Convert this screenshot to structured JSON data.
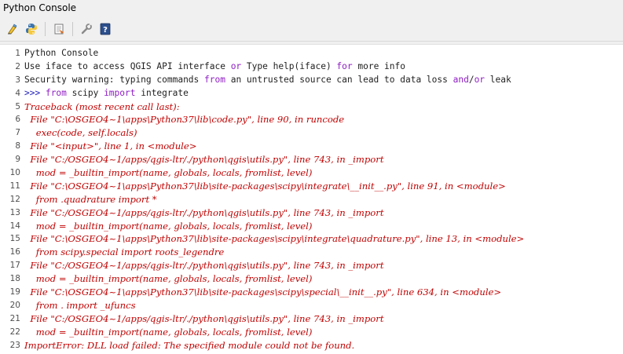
{
  "window": {
    "title": "Python Console"
  },
  "toolbar": {
    "icons": [
      "clear-console-icon",
      "python-icon",
      "run-script-icon",
      "settings-wrench-icon",
      "help-icon"
    ]
  },
  "colors": {
    "error_text": "#c00000",
    "keyword": "#8f1ec4",
    "prompt": "#2020c0",
    "line_number": "#505050"
  },
  "console": {
    "lines": [
      {
        "n": "1",
        "type": "normal",
        "segments": [
          {
            "t": "Python Console"
          }
        ]
      },
      {
        "n": "2",
        "type": "normal",
        "segments": [
          {
            "t": "Use iface to access QGIS API interface "
          },
          {
            "t": "or",
            "kw": true
          },
          {
            "t": " Type help(iface) "
          },
          {
            "t": "for",
            "kw": true
          },
          {
            "t": " more info"
          }
        ]
      },
      {
        "n": "3",
        "type": "normal",
        "segments": [
          {
            "t": "Security warning: typing commands "
          },
          {
            "t": "from",
            "kw": true
          },
          {
            "t": " an untrusted source can lead to data loss "
          },
          {
            "t": "and",
            "kw": true
          },
          {
            "t": "/"
          },
          {
            "t": "or",
            "kw": true
          },
          {
            "t": " leak"
          }
        ]
      },
      {
        "n": "4",
        "type": "normal",
        "segments": [
          {
            "t": ">>> ",
            "prompt": true
          },
          {
            "t": "from",
            "kw": true
          },
          {
            "t": " scipy "
          },
          {
            "t": "import",
            "kw": true
          },
          {
            "t": " integrate"
          }
        ]
      },
      {
        "n": "5",
        "type": "error",
        "segments": [
          {
            "t": "Traceback (most recent call last):"
          }
        ]
      },
      {
        "n": "6",
        "type": "error",
        "segments": [
          {
            "t": "  File \"C:\\OSGEO4~1\\apps\\Python37\\lib\\code.py\", line 90, in runcode"
          }
        ]
      },
      {
        "n": "7",
        "type": "error",
        "segments": [
          {
            "t": "    exec(code, self.locals)"
          }
        ]
      },
      {
        "n": "8",
        "type": "error",
        "segments": [
          {
            "t": "  File \"<input>\", line 1, in <module>"
          }
        ]
      },
      {
        "n": "9",
        "type": "error",
        "segments": [
          {
            "t": "  File \"C:/OSGEO4~1/apps/qgis-ltr/./python\\qgis\\utils.py\", line 743, in _import"
          }
        ]
      },
      {
        "n": "10",
        "type": "error",
        "segments": [
          {
            "t": "    mod = _builtin_import(name, globals, locals, fromlist, level)"
          }
        ]
      },
      {
        "n": "11",
        "type": "error",
        "segments": [
          {
            "t": "  File \"C:\\OSGEO4~1\\apps\\Python37\\lib\\site-packages\\scipy\\integrate\\__init__.py\", line 91, in <module>"
          }
        ]
      },
      {
        "n": "12",
        "type": "error",
        "segments": [
          {
            "t": "    from .quadrature import *"
          }
        ]
      },
      {
        "n": "13",
        "type": "error",
        "segments": [
          {
            "t": "  File \"C:/OSGEO4~1/apps/qgis-ltr/./python\\qgis\\utils.py\", line 743, in _import"
          }
        ]
      },
      {
        "n": "14",
        "type": "error",
        "segments": [
          {
            "t": "    mod = _builtin_import(name, globals, locals, fromlist, level)"
          }
        ]
      },
      {
        "n": "15",
        "type": "error",
        "segments": [
          {
            "t": "  File \"C:\\OSGEO4~1\\apps\\Python37\\lib\\site-packages\\scipy\\integrate\\quadrature.py\", line 13, in <module>"
          }
        ]
      },
      {
        "n": "16",
        "type": "error",
        "segments": [
          {
            "t": "    from scipy.special import roots_legendre"
          }
        ]
      },
      {
        "n": "17",
        "type": "error",
        "segments": [
          {
            "t": "  File \"C:/OSGEO4~1/apps/qgis-ltr/./python\\qgis\\utils.py\", line 743, in _import"
          }
        ]
      },
      {
        "n": "18",
        "type": "error",
        "segments": [
          {
            "t": "    mod = _builtin_import(name, globals, locals, fromlist, level)"
          }
        ]
      },
      {
        "n": "19",
        "type": "error",
        "segments": [
          {
            "t": "  File \"C:\\OSGEO4~1\\apps\\Python37\\lib\\site-packages\\scipy\\special\\__init__.py\", line 634, in <module>"
          }
        ]
      },
      {
        "n": "20",
        "type": "error",
        "segments": [
          {
            "t": "    from . import _ufuncs"
          }
        ]
      },
      {
        "n": "21",
        "type": "error",
        "segments": [
          {
            "t": "  File \"C:/OSGEO4~1/apps/qgis-ltr/./python\\qgis\\utils.py\", line 743, in _import"
          }
        ]
      },
      {
        "n": "22",
        "type": "error",
        "segments": [
          {
            "t": "    mod = _builtin_import(name, globals, locals, fromlist, level)"
          }
        ]
      },
      {
        "n": "23",
        "type": "error",
        "segments": [
          {
            "t": "ImportError: DLL load failed: The specified module could not be found."
          }
        ]
      }
    ]
  }
}
